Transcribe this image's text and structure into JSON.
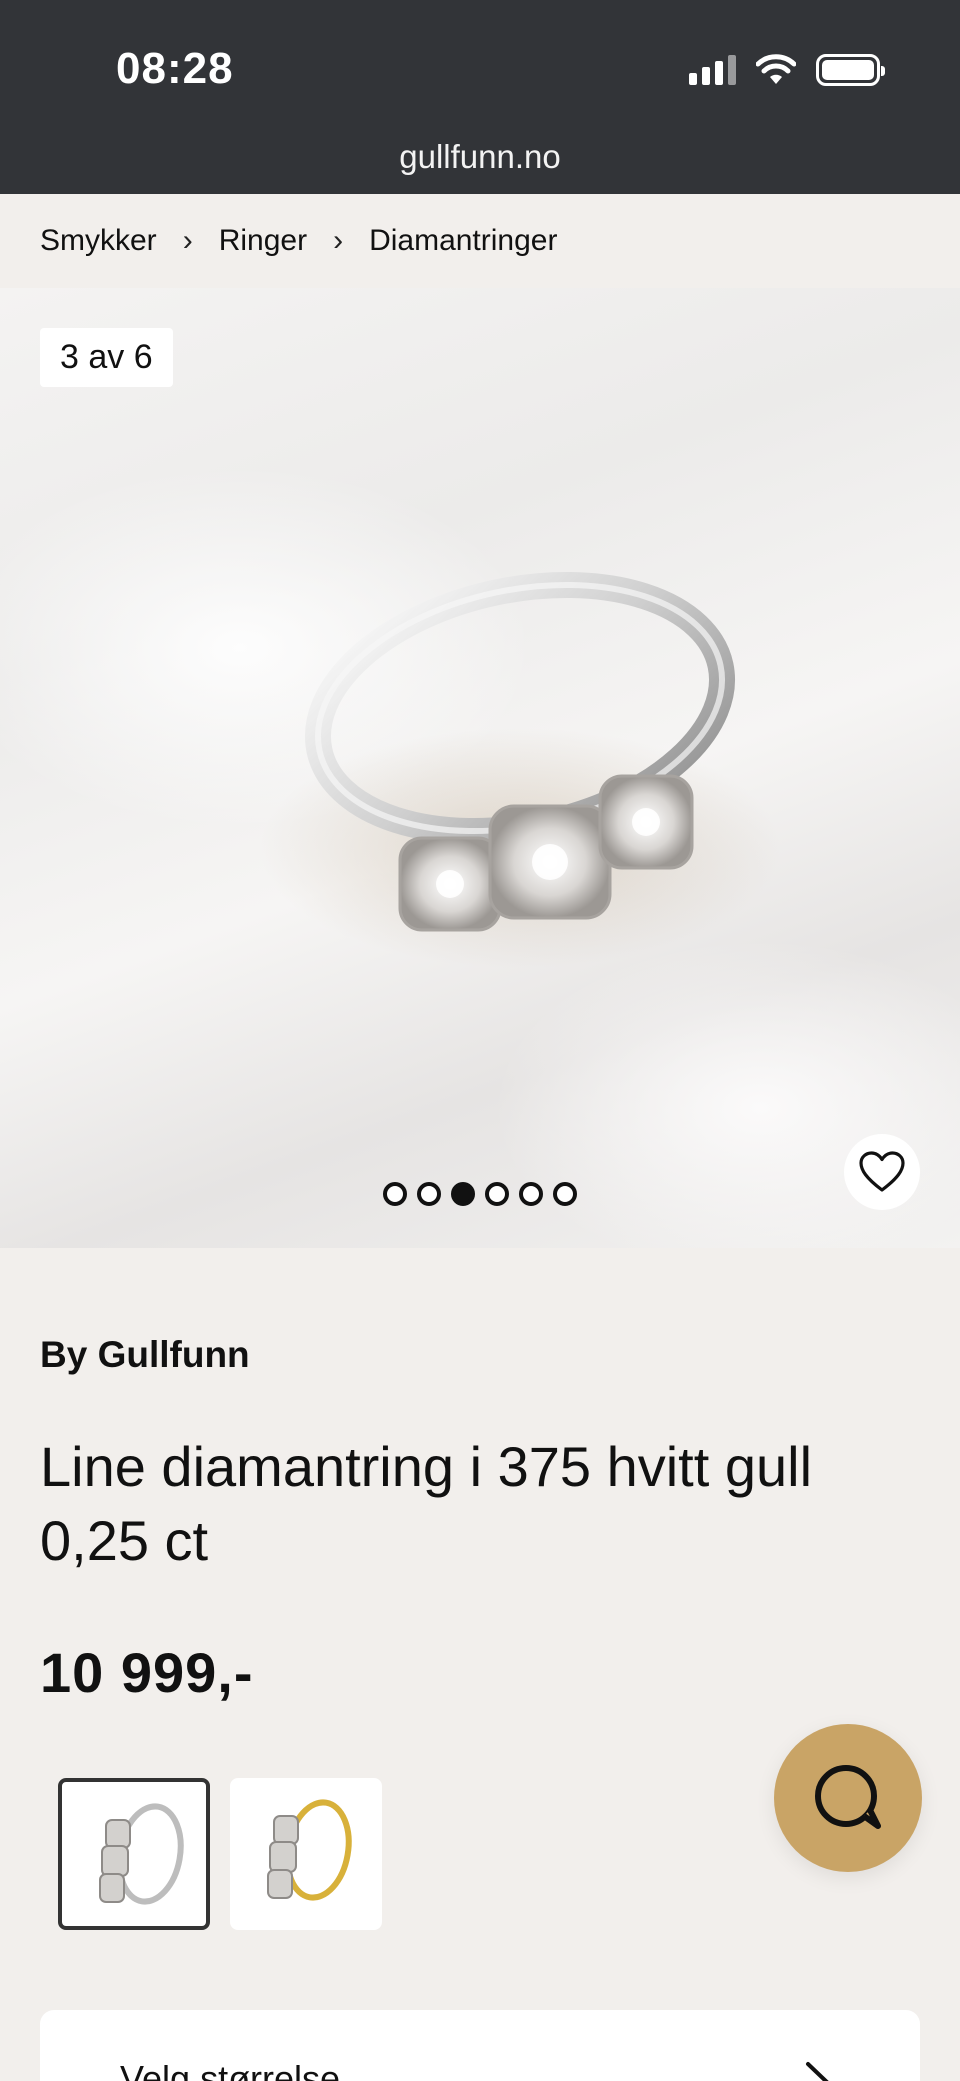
{
  "status_bar": {
    "time": "08:28"
  },
  "browser": {
    "url": "gullfunn.no"
  },
  "breadcrumb": {
    "items": [
      "Smykker",
      "Ringer",
      "Diamantringer"
    ],
    "separator": "›"
  },
  "gallery": {
    "counter": "3 av 6",
    "total_images": 6,
    "active_index": 3
  },
  "product": {
    "brand": "By Gullfunn",
    "title": "Line diamantring i 375 hvitt gull 0,25 ct",
    "price": "10 999,-"
  },
  "variants": [
    {
      "name": "white-gold",
      "selected": true
    },
    {
      "name": "yellow-gold",
      "selected": false
    }
  ],
  "size_selector": {
    "label": "Velg størrelse"
  },
  "colors": {
    "status_bar": "#323438",
    "page_bg": "#f2efec",
    "chat_button": "#c9a466"
  }
}
